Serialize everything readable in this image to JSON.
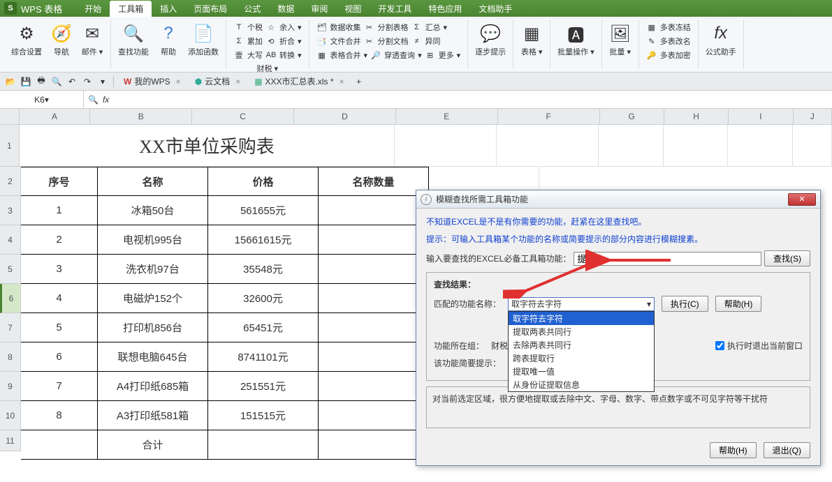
{
  "app": {
    "logo": "S",
    "name": "WPS 表格"
  },
  "menu": [
    "开始",
    "工具箱",
    "插入",
    "页面布局",
    "公式",
    "数据",
    "审阅",
    "视图",
    "开发工具",
    "特色应用",
    "文档助手"
  ],
  "menu_active": 1,
  "ribbon": {
    "g1": {
      "a": "综合设置",
      "b": "导航",
      "c": "邮件"
    },
    "g2": {
      "a": "查找功能",
      "b": "帮助",
      "c": "添加函数"
    },
    "g3": {
      "r1a": "个税",
      "r1b": "余入",
      "r2a": "累加",
      "r2b": "折合",
      "r3a": "大写",
      "r3b": "转换",
      "fin": "财税"
    },
    "g4": {
      "a": "数据收集",
      "b": "文件合并",
      "c": "表格合并",
      "d": "分割表格",
      "e": "分割文档",
      "f": "穿透查询",
      "g": "汇总",
      "h": "异同",
      "i": "更多"
    },
    "g5": {
      "a": "逐步提示"
    },
    "g6": {
      "a": "表格"
    },
    "g7": {
      "a": "批量操作"
    },
    "g8": {
      "a": "批量"
    },
    "g9": {
      "a": "多表冻结",
      "b": "多表改名",
      "c": "多表加密"
    },
    "g10": {
      "a": "公式助手"
    }
  },
  "tabs": {
    "t1": "我的WPS",
    "t2": "云文档",
    "t3": "XXX市汇总表.xls *"
  },
  "namebox": "K6",
  "cols": [
    "A",
    "B",
    "C",
    "D",
    "E",
    "F",
    "G",
    "H",
    "I",
    "J"
  ],
  "sheet": {
    "title": "XX市单位采购表",
    "headers": [
      "序号",
      "名称",
      "价格",
      "名称数量"
    ],
    "rows": [
      [
        "1",
        "冰箱50台",
        "561655元",
        ""
      ],
      [
        "2",
        "电视机995台",
        "15661615元",
        ""
      ],
      [
        "3",
        "洗衣机97台",
        "35548元",
        ""
      ],
      [
        "4",
        "电磁炉152个",
        "32600元",
        ""
      ],
      [
        "5",
        "打印机856台",
        "65451元",
        ""
      ],
      [
        "6",
        "联想电脑645台",
        "8741101元",
        ""
      ],
      [
        "7",
        "A4打印纸685箱",
        "251551元",
        ""
      ],
      [
        "8",
        "A3打印纸581箱",
        "151515元",
        ""
      ]
    ],
    "total_label": "合计"
  },
  "dialog": {
    "title": "模糊查找所需工具箱功能",
    "tip1": "不知道EXCEL是不是有你需要的功能，赶紧在这里查找吧。",
    "tip2": "提示：可输入工具箱某个功能的名称或简要提示的部分内容进行模糊搜素。",
    "label_input": "输入要查找的EXCEL必备工具箱功能：",
    "input_value": "提取",
    "btn_search": "查找(S)",
    "label_result": "查找结果：",
    "label_match": "匹配的功能名称：",
    "combo_selected": "取字符去字符",
    "combo_items": [
      "取字符去字符",
      "提取两表共同行",
      "去除两表共同行",
      "跨表提取行",
      "提取唯一值",
      "从身份证提取信息"
    ],
    "btn_exec": "执行(C)",
    "btn_help": "帮助(H)",
    "label_group": "功能所在组：",
    "group_value": "财税",
    "chk_label": "执行时退出当前窗口",
    "label_brief": "该功能简要提示：",
    "desc": "对当前选定区域，很方便地提取或去除中文、字母、数字、带点数字或不可见字符等干扰符",
    "btn_help2": "帮助(H)",
    "btn_exit": "退出(Q)"
  }
}
